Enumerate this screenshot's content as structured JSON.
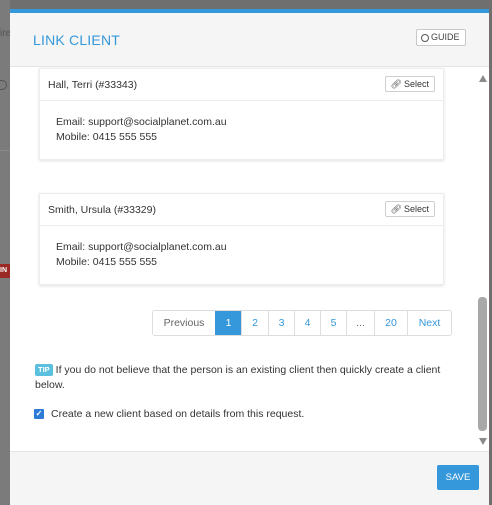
{
  "backdrop": {
    "fragment_text": "ire",
    "badge_text": "IN"
  },
  "modal": {
    "title": "LINK CLIENT",
    "guide_label": "GUIDE",
    "clients": [
      {
        "name": "Hall, Terri (#33343)",
        "select_label": "Select",
        "email": "Email: support@socialplanet.com.au",
        "mobile": "Mobile: 0415 555 555"
      },
      {
        "name": "Smith, Ursula (#33329)",
        "select_label": "Select",
        "email": "Email: support@socialplanet.com.au",
        "mobile": "Mobile: 0415 555 555"
      }
    ],
    "pagination": {
      "previous": "Previous",
      "pages": [
        "1",
        "2",
        "3",
        "4",
        "5",
        "...",
        "20"
      ],
      "next": "Next",
      "active": "1"
    },
    "tip": {
      "badge": "TIP",
      "text": "If you do not believe that the person is an existing client then quickly create a client below."
    },
    "create_checkbox": {
      "label": "Create a new client based on details from this request.",
      "checked": true
    },
    "save_label": "SAVE"
  },
  "colors": {
    "accent": "#3498db",
    "tip_badge": "#5bc0de",
    "checkbox": "#2f7bd8"
  }
}
